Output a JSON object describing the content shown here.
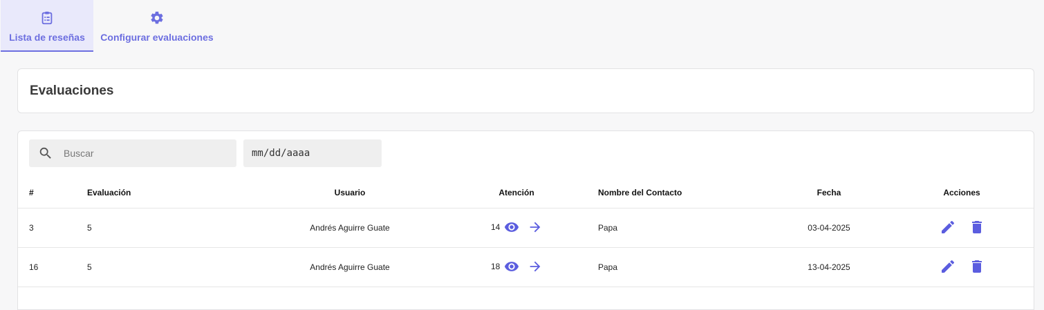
{
  "tabs": [
    {
      "label": "Lista de reseñas",
      "icon": "clipboard-list-icon",
      "active": true
    },
    {
      "label": "Configurar evaluaciones",
      "icon": "gear-icon",
      "active": false
    }
  ],
  "page_title": "Evaluaciones",
  "filters": {
    "search_placeholder": "Buscar",
    "date_placeholder": "mm/dd/aaaa"
  },
  "table": {
    "headers": [
      "#",
      "Evaluación",
      "Usuario",
      "Atención",
      "Nombre del Contacto",
      "Fecha",
      "Acciones"
    ],
    "rows": [
      {
        "id": "3",
        "rating": "5",
        "user": "Andrés Aguirre Guate",
        "attention": "14",
        "contact": "Papa",
        "date": "03-04-2025"
      },
      {
        "id": "16",
        "rating": "5",
        "user": "Andrés Aguirre Guate",
        "attention": "18",
        "contact": "Papa",
        "date": "13-04-2025"
      }
    ]
  },
  "colors": {
    "accent": "#6c6ee0",
    "action": "#5b5ddf",
    "tab_active_bg": "#e9e9fb"
  }
}
